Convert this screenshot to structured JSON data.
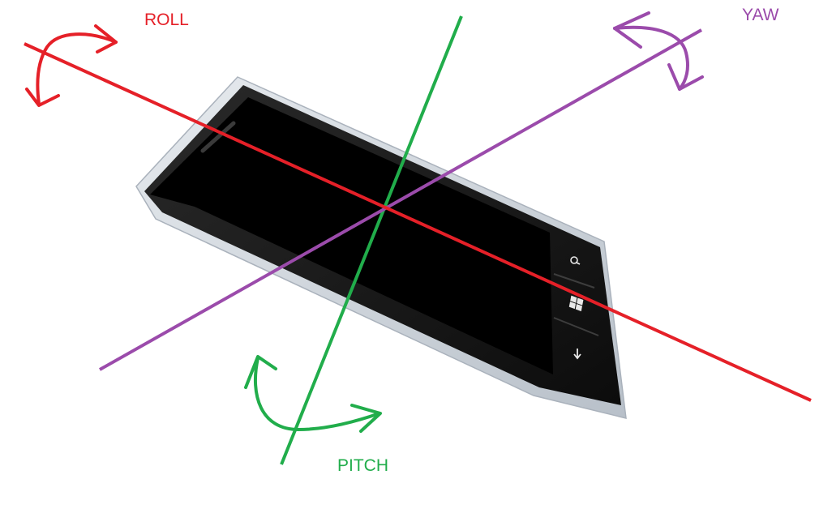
{
  "labels": {
    "roll": "ROLL",
    "yaw": "YAW",
    "pitch": "PITCH"
  },
  "colors": {
    "roll": "#e52028",
    "yaw": "#9b4bab",
    "pitch": "#21ad4b",
    "phone_body": "#141414",
    "phone_frame": "#c9cfd6",
    "background": "#ffffff"
  },
  "phone": {
    "buttons": [
      "search-icon",
      "windows-logo-icon",
      "back-arrow-icon"
    ]
  }
}
